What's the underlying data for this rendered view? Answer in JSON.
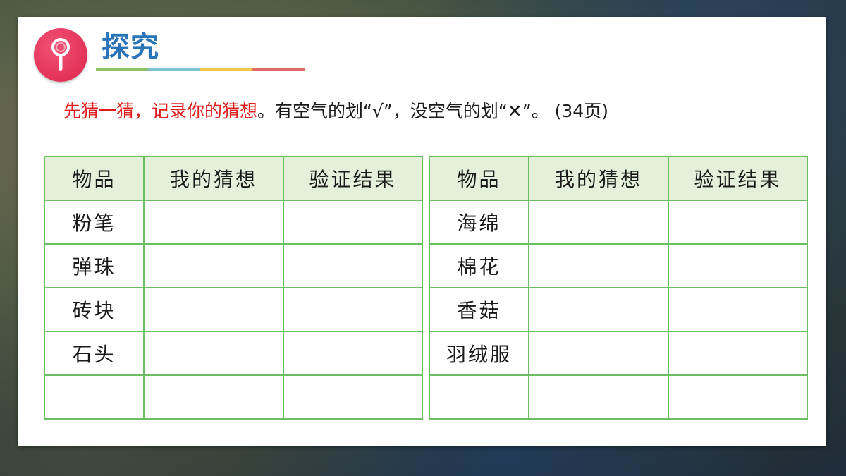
{
  "section": {
    "title": "探究",
    "icon": "magnifier-icon",
    "rule_colors": [
      "#8dc16a",
      "#7fc3d3",
      "#f0c64d",
      "#e06a6a"
    ]
  },
  "instruction": {
    "red_part": "先猜一猜，记录你的猜想",
    "black_part": "。有空气的划“√”，没空气的划“✕”。 (34页)"
  },
  "tables": {
    "headers": [
      "物品",
      "我的猜想",
      "验证结果"
    ],
    "left": [
      {
        "item": "粉笔",
        "guess": "",
        "result": ""
      },
      {
        "item": "弹珠",
        "guess": "",
        "result": ""
      },
      {
        "item": "砖块",
        "guess": "",
        "result": ""
      },
      {
        "item": "石头",
        "guess": "",
        "result": ""
      },
      {
        "item": "",
        "guess": "",
        "result": ""
      }
    ],
    "right": [
      {
        "item": "海绵",
        "guess": "",
        "result": ""
      },
      {
        "item": "棉花",
        "guess": "",
        "result": ""
      },
      {
        "item": "香菇",
        "guess": "",
        "result": ""
      },
      {
        "item": "羽绒服",
        "guess": "",
        "result": ""
      },
      {
        "item": "",
        "guess": "",
        "result": ""
      }
    ]
  },
  "colors": {
    "title_blue": "#2a74b8",
    "badge_red": "#e33258",
    "instruction_red": "#e01c1c",
    "table_border": "#6abf63",
    "header_fill": "#e4f0da"
  }
}
